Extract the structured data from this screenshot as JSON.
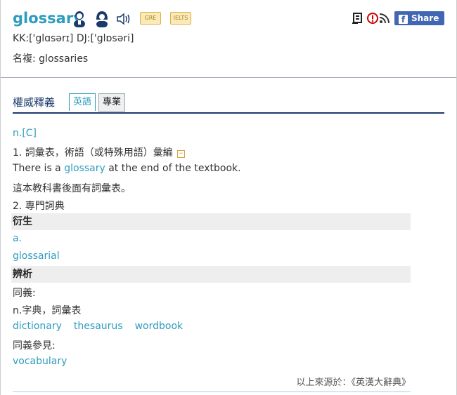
{
  "entry": {
    "word": "glossary",
    "pron_male_icon": "male-speaker-icon",
    "pron_female_icon": "female-speaker-icon",
    "audio_icon": "speaker-volume-icon",
    "badges": [
      "GRE",
      "IELTS"
    ],
    "share_label": "Share 0",
    "share_icon": "facebook-icon",
    "phonetic": "KK:['glɑsərɪ] DJ:['glɒsəri]",
    "plural": "名複: glossaries"
  },
  "tabs": {
    "title": "權威釋義",
    "items": [
      "英語",
      "專業"
    ],
    "active": "英語"
  },
  "definition": {
    "pos": "n.[C]",
    "sense1": "1. 詞彙表，術語（或特殊用語）彙編",
    "example_pre": "There is a ",
    "example_word": "glossary",
    "example_post": " at the end of the textbook.",
    "example_translation": "這本教科書後面有詞彙表。",
    "sense2": "2. 專門詞典"
  },
  "derivatives": {
    "heading": "衍生",
    "pos": "a.",
    "word": "glossarial"
  },
  "analysis": {
    "heading": "辨析",
    "synonyms_label": "同義:",
    "synonyms_pos": "n.字典，詞彙表",
    "synonyms": [
      "dictionary",
      "thesaurus",
      "wordbook"
    ],
    "see_also_label": "同義參見:",
    "see_also": "vocabulary"
  },
  "source": "以上來源於：《英漢大辭典》",
  "colors": {
    "accent": "#2e9cbf",
    "navy": "#1a3a6b",
    "facebook": "#4267b2"
  }
}
